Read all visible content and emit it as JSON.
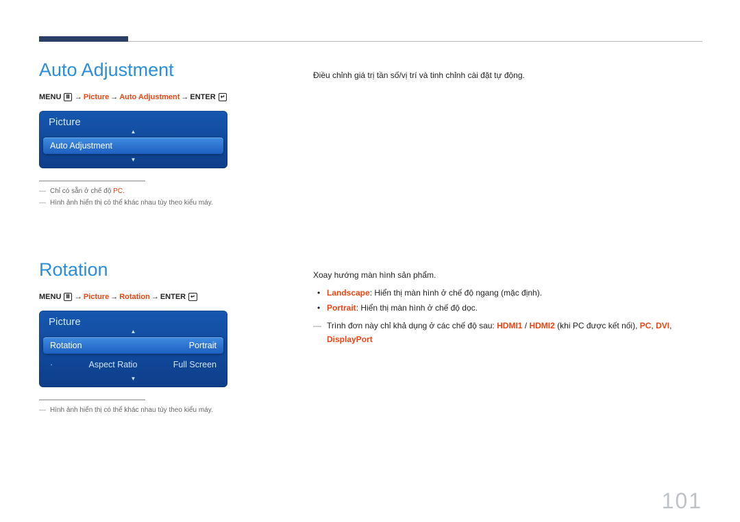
{
  "page_number": "101",
  "section1": {
    "title": "Auto Adjustment",
    "crumb": {
      "menu": "MENU",
      "arrow": "→",
      "p1": "Picture",
      "p2": "Auto Adjustment",
      "enter": "ENTER"
    },
    "osd": {
      "header": "Picture",
      "row1": "Auto Adjustment"
    },
    "notes": {
      "n1_pre": "Chỉ có sẵn ở chế độ ",
      "n1_red": "PC",
      "n1_post": ".",
      "n2": "Hình ảnh hiển thị có thể khác nhau tùy theo kiểu máy."
    },
    "desc": "Điều chỉnh giá trị tần số/vị trí và tinh chỉnh cài đặt tự động."
  },
  "section2": {
    "title": "Rotation",
    "crumb": {
      "menu": "MENU",
      "arrow": "→",
      "p1": "Picture",
      "p2": "Rotation",
      "enter": "ENTER"
    },
    "osd": {
      "header": "Picture",
      "row1_label": "Rotation",
      "row1_value": "Portrait",
      "row2_label": "Aspect Ratio",
      "row2_value": "Full Screen"
    },
    "notes": {
      "n1": "Hình ảnh hiển thị có thể khác nhau tùy theo kiểu máy."
    },
    "desc_intro": "Xoay hướng màn hình sản phẩm.",
    "b1_red": "Landscape",
    "b1_txt": ": Hiển thị màn hình ở chế độ ngang (mặc định).",
    "b2_red": "Portrait",
    "b2_txt": ": Hiển thị màn hình ở chế độ dọc.",
    "avail_pre": "Trình đơn này chỉ khả dụng ở các chế độ sau: ",
    "hdmi1": "HDMI1",
    "slash": " / ",
    "hdmi2": "HDMI2",
    "avail_mid": " (khi PC được kết nối), ",
    "pc": "PC",
    "comma": ", ",
    "dvi": "DVI",
    "dp": "DisplayPort"
  }
}
